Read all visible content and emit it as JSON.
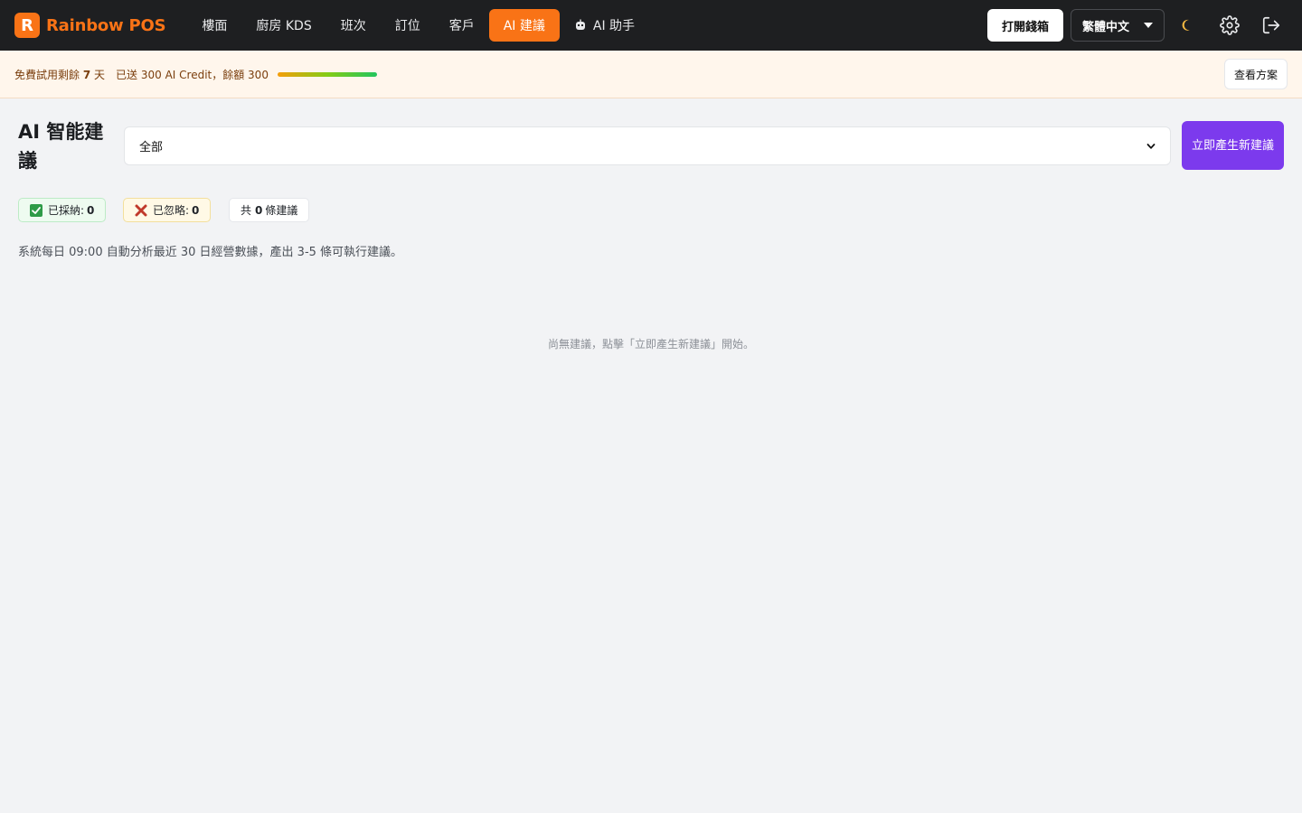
{
  "brand": {
    "logo_letter": "R",
    "name": "Rainbow POS",
    "color": "#f97316"
  },
  "nav": {
    "items": [
      {
        "label": "樓面"
      },
      {
        "label": "廚房 KDS"
      },
      {
        "label": "班次"
      },
      {
        "label": "訂位"
      },
      {
        "label": "客戶"
      },
      {
        "label": "AI 建議",
        "active": true
      },
      {
        "label": "AI 助手",
        "icon": "robot-icon"
      }
    ]
  },
  "header_actions": {
    "open_drawer": "打開錢箱",
    "language": "繁體中文",
    "icons": [
      "moon-icon",
      "gear-icon",
      "logout-icon"
    ]
  },
  "trial": {
    "prefix": "免費試用剩餘",
    "days": "7",
    "suffix": "天",
    "credit_text": "已送 300 AI Credit，餘額 300",
    "credit_fraction": 1.0,
    "view_plans": "查看方案"
  },
  "main": {
    "title": "AI 智能建議",
    "filter_value": "全部",
    "generate_button": "立即產生新建議",
    "stats": {
      "adopted_label": "已採納:",
      "adopted_count": "0",
      "ignored_label": "已忽略:",
      "ignored_count": "0",
      "total_prefix": "共",
      "total_count": "0",
      "total_suffix": "條建議"
    },
    "description": "系統每日 09:00 自動分析最近 30 日經營數據，產出 3-5 條可執行建議。",
    "empty_state": "尚無建議，點擊「立即產生新建議」開始。"
  },
  "colors": {
    "accent": "#f97316",
    "primary": "#7c3aed",
    "topbar": "#1e1f21"
  }
}
